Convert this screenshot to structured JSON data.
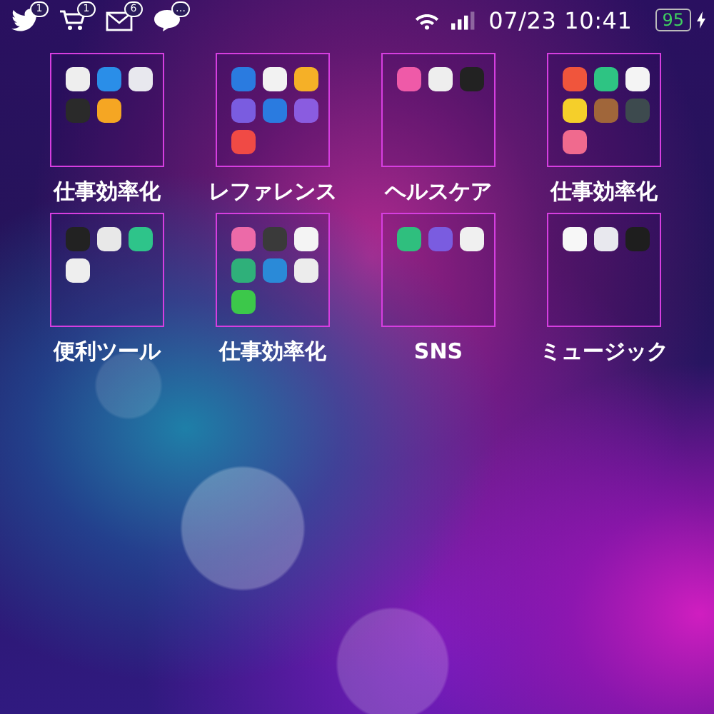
{
  "status_bar": {
    "notifications": [
      {
        "kind": "bird",
        "badge": "1"
      },
      {
        "kind": "cart",
        "badge": "1"
      },
      {
        "kind": "mail",
        "badge": "6"
      },
      {
        "kind": "chat",
        "badge": "…"
      }
    ],
    "time": "07/23 10:41",
    "battery": {
      "text": "95",
      "charging": true
    }
  },
  "folders": [
    {
      "label": "仕事効率化",
      "apps": [
        {
          "color": "#eeeeee"
        },
        {
          "color": "#2a8ee8"
        },
        {
          "color": "#e8e8ee"
        },
        {
          "color": "#2a2a2a"
        },
        {
          "color": "#f5a623"
        }
      ]
    },
    {
      "label": "レファレンス",
      "apps": [
        {
          "color": "#2a7be0"
        },
        {
          "color": "#f2f2f2"
        },
        {
          "color": "#f5b027"
        },
        {
          "color": "#7a5ce0"
        },
        {
          "color": "#2a7be0"
        },
        {
          "color": "#8a5ce0"
        },
        {
          "color": "#f04a45"
        }
      ]
    },
    {
      "label": "ヘルスケア",
      "apps": [
        {
          "color": "#ef5aa8"
        },
        {
          "color": "#eeeeee"
        },
        {
          "color": "#222222"
        }
      ]
    },
    {
      "label": "仕事効率化",
      "apps": [
        {
          "color": "#f0553c"
        },
        {
          "color": "#2ec483"
        },
        {
          "color": "#f4f4f4"
        },
        {
          "color": "#f5cf2a"
        },
        {
          "color": "#a0663a"
        },
        {
          "color": "#3d4a4e"
        },
        {
          "color": "#f06a8e"
        }
      ]
    },
    {
      "label": "便利ツール",
      "apps": [
        {
          "color": "#222222"
        },
        {
          "color": "#e8e8e8"
        },
        {
          "color": "#2ec48a"
        },
        {
          "color": "#eeeeee"
        }
      ]
    },
    {
      "label": "仕事効率化",
      "apps": [
        {
          "color": "#ec6aa8"
        },
        {
          "color": "#3a3a3a"
        },
        {
          "color": "#f4f4f4"
        },
        {
          "color": "#2fb07a"
        },
        {
          "color": "#2a8ad8"
        },
        {
          "color": "#ececec"
        },
        {
          "color": "#3cc84a"
        }
      ]
    },
    {
      "label": "SNS",
      "apps": [
        {
          "color": "#2fbf7e"
        },
        {
          "color": "#7a5ce0"
        },
        {
          "color": "#f0f0f0"
        }
      ]
    },
    {
      "label": "ミュージック",
      "apps": [
        {
          "color": "#f7f7f7"
        },
        {
          "color": "#e8e8ee"
        },
        {
          "color": "#1e1e1e"
        }
      ]
    }
  ]
}
